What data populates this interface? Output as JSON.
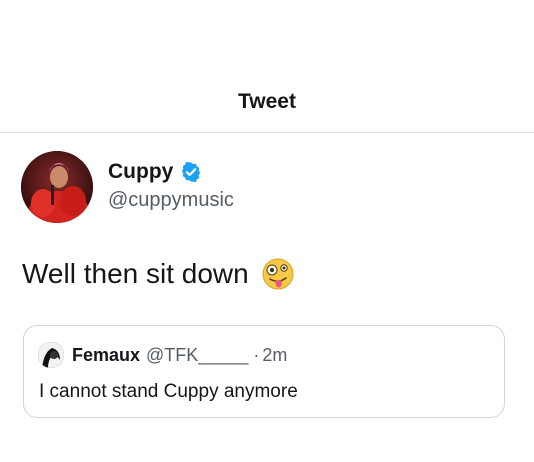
{
  "header": {
    "title": "Tweet"
  },
  "tweet": {
    "author_name": "Cuppy",
    "author_handle": "@cuppymusic",
    "verified": true,
    "text": "Well then sit down",
    "emoji_icon": "zany-face-icon"
  },
  "quoted_tweet": {
    "author_name": "Femaux",
    "author_handle": "@TFK_____",
    "separator": "·",
    "time": "2m",
    "text": "I cannot stand Cuppy anymore"
  },
  "colors": {
    "text_primary": "#14171a",
    "text_secondary": "#555d64",
    "verified_blue": "#1da1f2",
    "divider": "#dfe3e6",
    "card_border": "#cfd6db"
  }
}
